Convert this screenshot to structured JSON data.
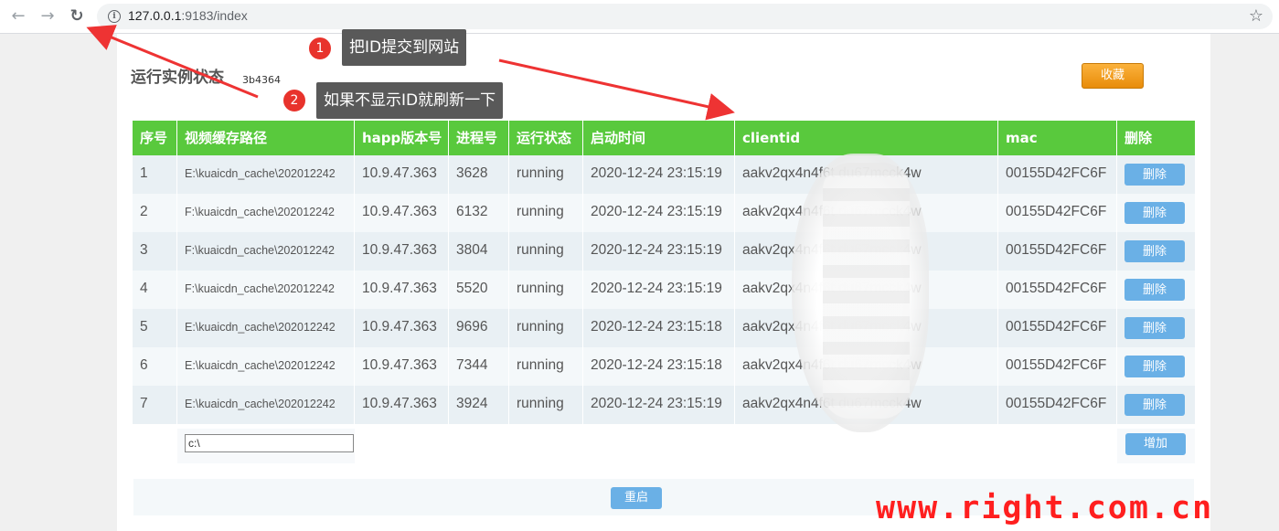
{
  "browser": {
    "url_host": "127.0.0.1",
    "url_rest": ":9183/index"
  },
  "page": {
    "title": "运行实例状态",
    "id": "3b4364",
    "favorite_label": "收藏"
  },
  "table": {
    "headers": [
      "序号",
      "视频缓存路径",
      "happ版本号",
      "进程号",
      "运行状态",
      "启动时间",
      "clientid",
      "mac",
      "删除"
    ],
    "rows": [
      {
        "no": "1",
        "path": "E:\\kuaicdn_cache\\202012242",
        "version": "10.9.47.363",
        "pid": "3628",
        "status": "running",
        "start": "2020-12-24 23:15:19",
        "clientid": "aakv2qx4n4f6t       du67mcck4w",
        "mac": "00155D42FC6F",
        "action": "删除"
      },
      {
        "no": "2",
        "path": "F:\\kuaicdn_cache\\202012242",
        "version": "10.9.47.363",
        "pid": "6132",
        "status": "running",
        "start": "2020-12-24 23:15:19",
        "clientid": "aakv2qx4n4f6t       du67mcck4w",
        "mac": "00155D42FC6F",
        "action": "删除"
      },
      {
        "no": "3",
        "path": "F:\\kuaicdn_cache\\202012242",
        "version": "10.9.47.363",
        "pid": "3804",
        "status": "running",
        "start": "2020-12-24 23:15:19",
        "clientid": "aakv2qx4n4f6t       du67mcck4w",
        "mac": "00155D42FC6F",
        "action": "删除"
      },
      {
        "no": "4",
        "path": "F:\\kuaicdn_cache\\202012242",
        "version": "10.9.47.363",
        "pid": "5520",
        "status": "running",
        "start": "2020-12-24 23:15:19",
        "clientid": "aakv2qx4n4f6t       du67mcck4w",
        "mac": "00155D42FC6F",
        "action": "删除"
      },
      {
        "no": "5",
        "path": "E:\\kuaicdn_cache\\202012242",
        "version": "10.9.47.363",
        "pid": "9696",
        "status": "running",
        "start": "2020-12-24 23:15:18",
        "clientid": "aakv2qx4n4f6t       du67mcck4w",
        "mac": "00155D42FC6F",
        "action": "删除"
      },
      {
        "no": "6",
        "path": "E:\\kuaicdn_cache\\202012242",
        "version": "10.9.47.363",
        "pid": "7344",
        "status": "running",
        "start": "2020-12-24 23:15:18",
        "clientid": "aakv2qx4n4f6t       du67mcck4w",
        "mac": "00155D42FC6F",
        "action": "删除"
      },
      {
        "no": "7",
        "path": "E:\\kuaicdn_cache\\202012242",
        "version": "10.9.47.363",
        "pid": "3924",
        "status": "running",
        "start": "2020-12-24 23:15:19",
        "clientid": "aakv2qx4n4f6t       du67mcck4w",
        "mac": "00155D42FC6F",
        "action": "删除"
      }
    ],
    "new_path_value": "c:\\",
    "add_label": "增加"
  },
  "footer": {
    "restart_label": "重启"
  },
  "annotations": {
    "step1_number": "1",
    "step1_text": "把ID提交到网站",
    "step2_number": "2",
    "step2_text": "如果不显示ID就刷新一下",
    "arrow_color": "#ee3333"
  },
  "watermark": "www.right.com.cn",
  "colors": {
    "header_green": "#59c93d",
    "button_blue": "#6ab0e6",
    "favorite_orange": "#f5a11e"
  }
}
